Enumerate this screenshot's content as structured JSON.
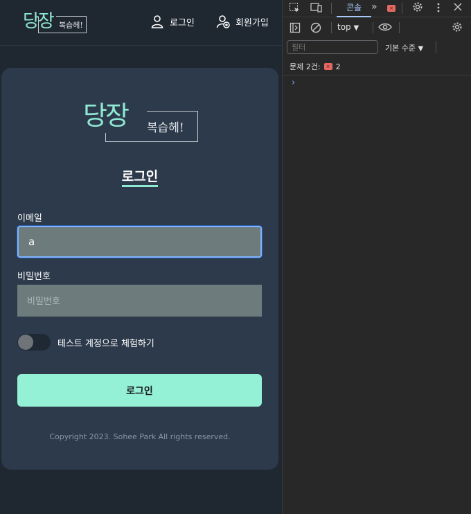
{
  "header": {
    "logo_main": "당장",
    "logo_sub": "복습헤!",
    "nav_login": "로그인",
    "nav_signup": "회원가입"
  },
  "card": {
    "logo_main": "당장",
    "logo_sub": "복습헤!",
    "title": "로그인",
    "email_label": "이메일",
    "email_value": "a",
    "password_label": "비밀번호",
    "password_placeholder": "비밀번호",
    "toggle_label": "테스트 계정으로 체험하기",
    "toggle_on": false,
    "submit_label": "로그인",
    "copyright": "Copyright 2023. Sohee Park All rights reserved."
  },
  "devtools": {
    "tab_console": "콘솔",
    "context": "top",
    "filter_placeholder": "필터",
    "level": "기본 수준",
    "issues_label": "문제 2건:",
    "issues_count": "2",
    "prompt": "›"
  },
  "colors": {
    "accent": "#94f1d6",
    "logo": "#8ee8d2",
    "card_bg": "#2d3a4b",
    "page_bg": "#1f2731",
    "input_bg": "#6d7b7d",
    "focus_ring": "#7fb3ff"
  },
  "icons": [
    "user-icon",
    "user-add-icon",
    "inspect-icon",
    "device-toggle-icon",
    "more-tabs-icon",
    "error-badge-icon",
    "settings-icon",
    "kebab-menu-icon",
    "close-icon",
    "sidebar-toggle-icon",
    "clear-console-icon",
    "dropdown-arrow-icon",
    "eye-icon"
  ]
}
